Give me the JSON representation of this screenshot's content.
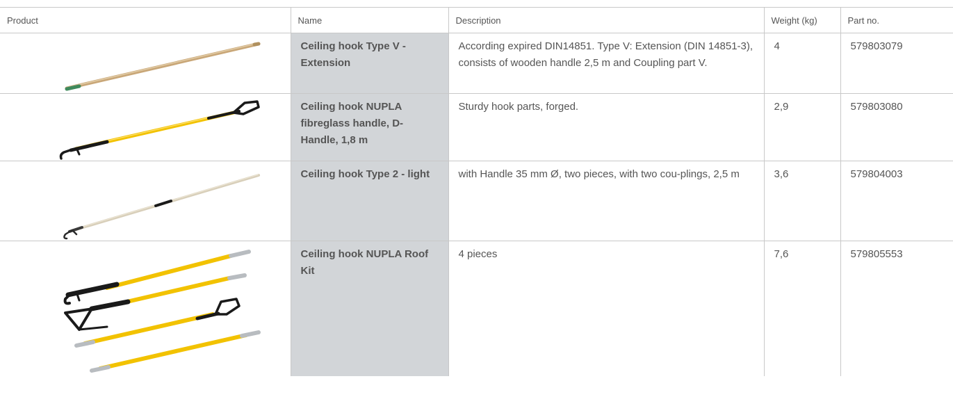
{
  "headers": {
    "product": "Product",
    "name": "Name",
    "description": "Description",
    "weight": "Weight (kg)",
    "part_no": "Part no."
  },
  "rows": [
    {
      "image_icon": "wooden-extension-handle-image",
      "name": "Ceiling hook Type V - Extension",
      "description": "According expired DIN14851. Type V: Extension (DIN 14851-3), consists of wooden handle 2,5 m and Coupling part V.",
      "weight": "4",
      "part_no": "579803079"
    },
    {
      "image_icon": "fibreglass-d-handle-hook-image",
      "name": "Ceiling hook NUPLA fibreglass handle, D-Handle, 1,8 m",
      "description": "Sturdy hook parts, forged.",
      "weight": "2,9",
      "part_no": "579803080"
    },
    {
      "image_icon": "two-piece-light-hook-image",
      "name": "Ceiling hook Type 2 - light",
      "description": "with Handle 35 mm Ø, two pieces, with two cou-plings, 2,5 m",
      "weight": "3,6",
      "part_no": "579804003"
    },
    {
      "image_icon": "nupla-roof-kit-image",
      "name": "Ceiling hook NUPLA Roof Kit",
      "description": "4 pieces",
      "weight": "7,6",
      "part_no": "579805553"
    }
  ],
  "colors": {
    "name_column_bg": "#d2d5d8",
    "border": "#c8c8c8",
    "fibreglass_yellow": "#f2c200",
    "wood": "#c9a778"
  }
}
